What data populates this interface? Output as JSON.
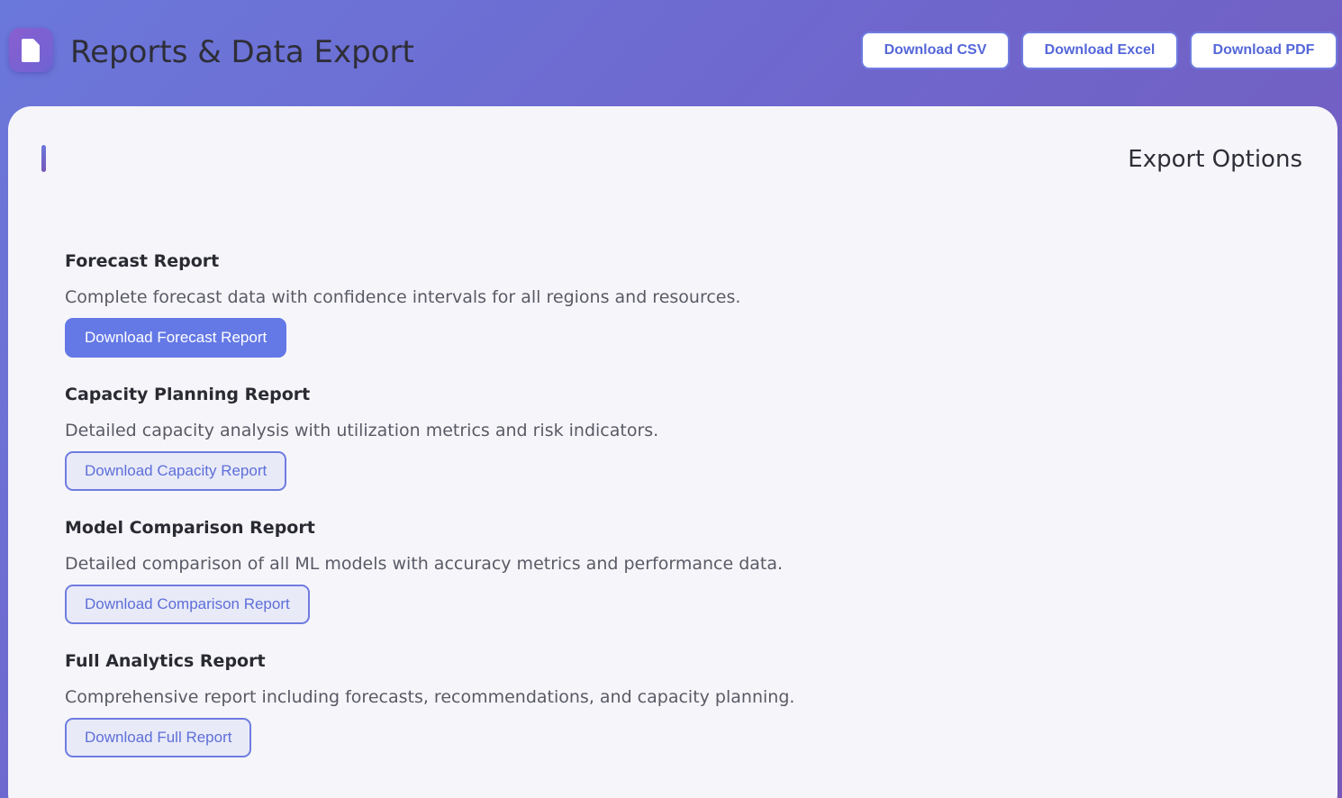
{
  "header": {
    "title": "Reports & Data Export",
    "app_icon": "document-icon",
    "buttons": {
      "csv": "Download CSV",
      "excel": "Download Excel",
      "pdf": "Download PDF"
    }
  },
  "export": {
    "section_title": "Export Options",
    "reports": [
      {
        "title": "Forecast Report",
        "description": "Complete forecast data with confidence intervals for all regions and resources.",
        "button": "Download Forecast Report",
        "style": "primary"
      },
      {
        "title": "Capacity Planning Report",
        "description": "Detailed capacity analysis with utilization metrics and risk indicators.",
        "button": "Download Capacity Report",
        "style": "secondary"
      },
      {
        "title": "Model Comparison Report",
        "description": "Detailed comparison of all ML models with accuracy metrics and performance data.",
        "button": "Download Comparison Report",
        "style": "secondary"
      },
      {
        "title": "Full Analytics Report",
        "description": "Comprehensive report including forecasts, recommendations, and capacity planning.",
        "button": "Download Full Report",
        "style": "secondary"
      }
    ]
  },
  "colors": {
    "primary": "#6479e6",
    "accent_border": "#6f7ce0",
    "background_start": "#6b78db",
    "background_end": "#7658b8",
    "card": "#f6f6fa"
  }
}
